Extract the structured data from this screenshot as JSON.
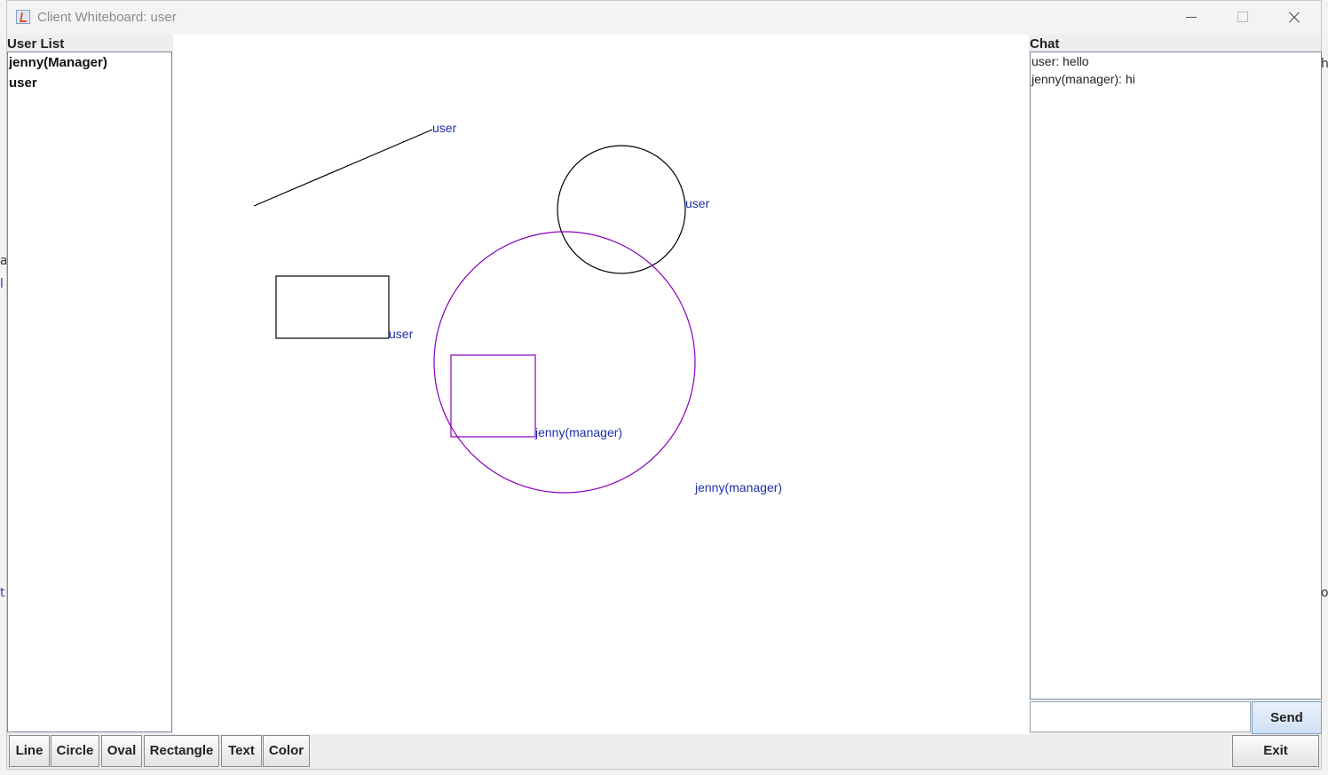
{
  "window": {
    "title": "Client Whiteboard: user"
  },
  "user_list": {
    "label": "User List",
    "users": [
      "jenny(Manager)",
      "user"
    ]
  },
  "whiteboard": {
    "shapes": [
      {
        "type": "line",
        "color": "#000000",
        "label": "user"
      },
      {
        "type": "circle",
        "color": "#000000",
        "label": "user"
      },
      {
        "type": "rectangle",
        "color": "#000000",
        "label": "user"
      },
      {
        "type": "circle",
        "color": "#8800bb",
        "label": "jenny(manager)"
      },
      {
        "type": "rectangle",
        "color": "#8800bb",
        "label": "jenny(manager)"
      }
    ],
    "label_color": "#1e2fa8"
  },
  "chat": {
    "label": "Chat",
    "messages": [
      "user: hello",
      "jenny(manager): hi"
    ],
    "input_value": "",
    "send_label": "Send"
  },
  "toolbar": {
    "buttons": [
      "Line",
      "Circle",
      "Oval",
      "Rectangle",
      "Text",
      "Color"
    ],
    "exit_label": "Exit"
  }
}
